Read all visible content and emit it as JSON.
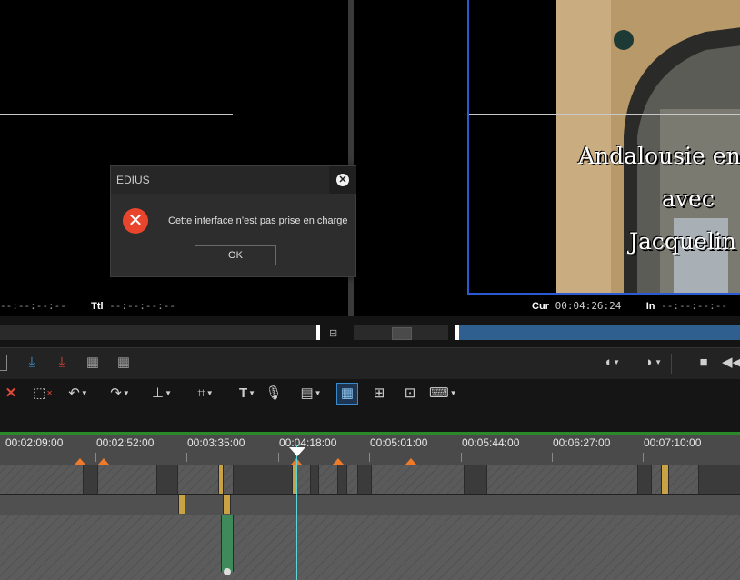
{
  "player": {
    "in_timecode": "--:--:--:--",
    "ttl_label": "Ttl",
    "ttl_timecode": "--:--:--:--"
  },
  "recorder": {
    "overlay_lines": [
      "Andalousie en",
      "avec",
      "Jacquelin"
    ],
    "cur_label": "Cur",
    "cur_timecode": "00:04:26:24",
    "in_label": "In",
    "in_timecode": "--:--:--:--"
  },
  "dialog": {
    "title": "EDIUS",
    "message": "Cette interface n’est pas prise en charge",
    "ok_label": "OK"
  },
  "timeline": {
    "ruler_labels": [
      "00:02:09:00",
      "00:02:52:00",
      "00:03:35:00",
      "00:04:18:00",
      "00:05:01:00",
      "00:05:44:00",
      "00:06:27:00",
      "00:07:10:00"
    ]
  },
  "colors": {
    "accent_blue": "#2a5bd0",
    "error_red": "#e8452c",
    "marker_orange": "#f07a2a",
    "cursor_cyan": "#5ad6d6"
  },
  "icons": [
    "close-icon",
    "error-icon",
    "delete-icon",
    "ripple-icon",
    "undo-icon",
    "redo-icon",
    "set-in-out-icon",
    "crop-icon",
    "title-icon",
    "voice-over-icon",
    "clip-marker-icon",
    "timeline-view-icon",
    "mixer-icon",
    "multicam-icon",
    "keyboard-icon",
    "stop-icon",
    "rewind-icon",
    "mark-in-icon",
    "mark-out-icon"
  ]
}
